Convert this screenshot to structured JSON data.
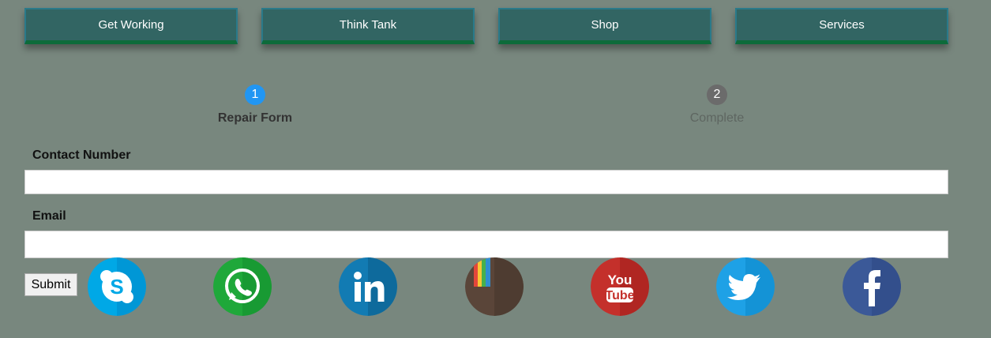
{
  "nav": {
    "items": [
      {
        "label": "Get Working"
      },
      {
        "label": "Think Tank"
      },
      {
        "label": "Shop"
      },
      {
        "label": "Services"
      }
    ]
  },
  "steps": [
    {
      "number": "1",
      "label": "Repair Form",
      "state": "active",
      "color": "#2196f3"
    },
    {
      "number": "2",
      "label": "Complete",
      "state": "inactive",
      "color": "#6b6b6b"
    }
  ],
  "form": {
    "contact_label": "Contact Number",
    "contact_value": "",
    "email_label": "Email",
    "email_value": "",
    "submit_label": "Submit"
  },
  "social": {
    "icons": [
      "skype-icon",
      "whatsapp-icon",
      "linkedin-icon",
      "instagram-icon",
      "youtube-icon",
      "twitter-icon",
      "facebook-icon"
    ],
    "youtube_text_top": "You",
    "youtube_text_bottom": "Tube"
  },
  "colors": {
    "background": "#78877e",
    "nav_button": "#326563",
    "nav_border_bottom": "#0d6b3a",
    "step_active": "#2196f3",
    "step_inactive": "#6b6b6b"
  }
}
